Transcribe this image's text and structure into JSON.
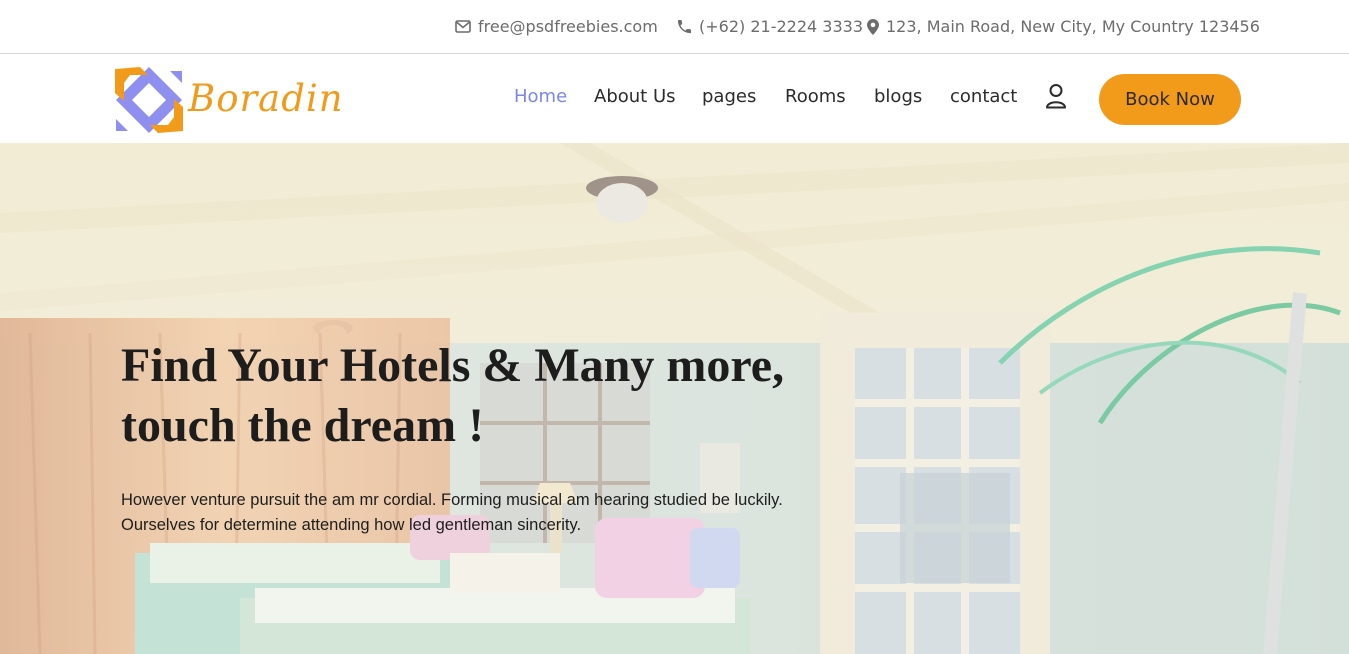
{
  "topbar": {
    "email": "free@psdfreebies.com",
    "phone": "(+62) 21-2224 3333",
    "address": "123, Main Road, New City, My Country 123456"
  },
  "header": {
    "logo_text": "Boradin",
    "nav": {
      "home": "Home",
      "about": "About Us",
      "pages": "pages",
      "rooms": "Rooms",
      "blogs": "blogs",
      "contact": "contact"
    },
    "book_label": "Book Now"
  },
  "hero": {
    "title_line1": "Find Your Hotels & Many more,",
    "title_line2": "touch the dream !",
    "text_line1": "However venture pursuit the am mr cordial. Forming musical am hearing studied be luckily.",
    "text_line2": "Ourselves for determine attending how led gentleman sincerity."
  },
  "colors": {
    "accent": "#f29a1a",
    "active_nav": "#7a86e8",
    "logo_purple": "#8f8ff0"
  },
  "icons": {
    "email": "envelope-icon",
    "phone": "phone-icon",
    "address": "map-marker-icon",
    "user": "user-icon"
  }
}
